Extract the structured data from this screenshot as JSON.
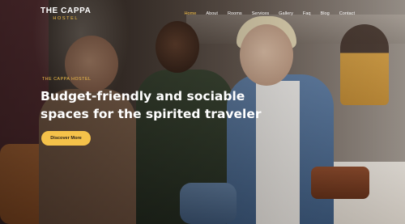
{
  "brand": {
    "name": "THE CAPPA",
    "sub": "HOSTEL",
    "accent_color": "#f5c24a"
  },
  "nav": {
    "items": [
      {
        "label": "Home",
        "active": true
      },
      {
        "label": "About",
        "active": false
      },
      {
        "label": "Rooms",
        "active": false
      },
      {
        "label": "Services",
        "active": false
      },
      {
        "label": "Gallery",
        "active": false
      },
      {
        "label": "Faq",
        "active": false
      },
      {
        "label": "Blog",
        "active": false
      },
      {
        "label": "Contact",
        "active": false
      }
    ]
  },
  "hero": {
    "eyebrow": "THE CAPPA HOSTEL",
    "headline": "Budget-friendly and sociable spaces for the spirited traveler",
    "cta_label": "Discover More"
  }
}
